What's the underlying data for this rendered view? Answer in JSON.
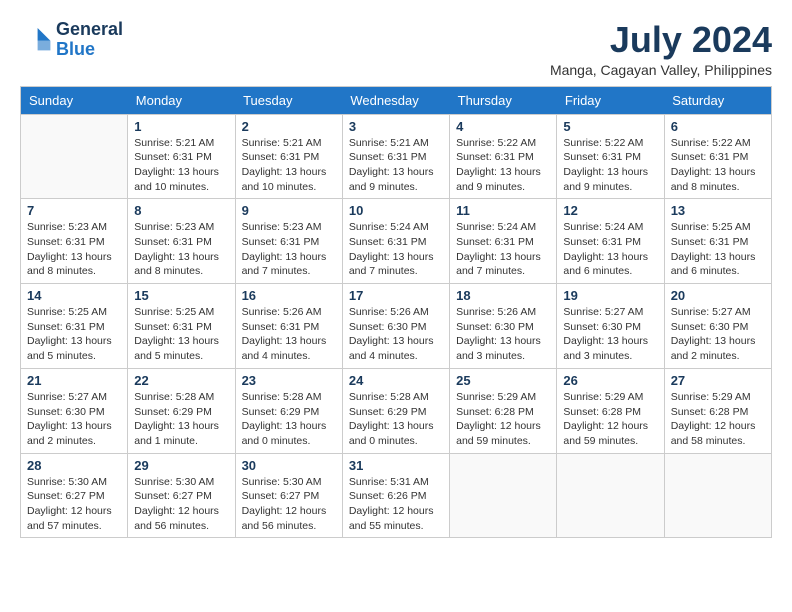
{
  "logo": {
    "line1": "General",
    "line2": "Blue"
  },
  "title": "July 2024",
  "location": "Manga, Cagayan Valley, Philippines",
  "days_header": [
    "Sunday",
    "Monday",
    "Tuesday",
    "Wednesday",
    "Thursday",
    "Friday",
    "Saturday"
  ],
  "weeks": [
    [
      {
        "day": "",
        "info": ""
      },
      {
        "day": "1",
        "info": "Sunrise: 5:21 AM\nSunset: 6:31 PM\nDaylight: 13 hours\nand 10 minutes."
      },
      {
        "day": "2",
        "info": "Sunrise: 5:21 AM\nSunset: 6:31 PM\nDaylight: 13 hours\nand 10 minutes."
      },
      {
        "day": "3",
        "info": "Sunrise: 5:21 AM\nSunset: 6:31 PM\nDaylight: 13 hours\nand 9 minutes."
      },
      {
        "day": "4",
        "info": "Sunrise: 5:22 AM\nSunset: 6:31 PM\nDaylight: 13 hours\nand 9 minutes."
      },
      {
        "day": "5",
        "info": "Sunrise: 5:22 AM\nSunset: 6:31 PM\nDaylight: 13 hours\nand 9 minutes."
      },
      {
        "day": "6",
        "info": "Sunrise: 5:22 AM\nSunset: 6:31 PM\nDaylight: 13 hours\nand 8 minutes."
      }
    ],
    [
      {
        "day": "7",
        "info": "Sunrise: 5:23 AM\nSunset: 6:31 PM\nDaylight: 13 hours\nand 8 minutes."
      },
      {
        "day": "8",
        "info": "Sunrise: 5:23 AM\nSunset: 6:31 PM\nDaylight: 13 hours\nand 8 minutes."
      },
      {
        "day": "9",
        "info": "Sunrise: 5:23 AM\nSunset: 6:31 PM\nDaylight: 13 hours\nand 7 minutes."
      },
      {
        "day": "10",
        "info": "Sunrise: 5:24 AM\nSunset: 6:31 PM\nDaylight: 13 hours\nand 7 minutes."
      },
      {
        "day": "11",
        "info": "Sunrise: 5:24 AM\nSunset: 6:31 PM\nDaylight: 13 hours\nand 7 minutes."
      },
      {
        "day": "12",
        "info": "Sunrise: 5:24 AM\nSunset: 6:31 PM\nDaylight: 13 hours\nand 6 minutes."
      },
      {
        "day": "13",
        "info": "Sunrise: 5:25 AM\nSunset: 6:31 PM\nDaylight: 13 hours\nand 6 minutes."
      }
    ],
    [
      {
        "day": "14",
        "info": "Sunrise: 5:25 AM\nSunset: 6:31 PM\nDaylight: 13 hours\nand 5 minutes."
      },
      {
        "day": "15",
        "info": "Sunrise: 5:25 AM\nSunset: 6:31 PM\nDaylight: 13 hours\nand 5 minutes."
      },
      {
        "day": "16",
        "info": "Sunrise: 5:26 AM\nSunset: 6:31 PM\nDaylight: 13 hours\nand 4 minutes."
      },
      {
        "day": "17",
        "info": "Sunrise: 5:26 AM\nSunset: 6:30 PM\nDaylight: 13 hours\nand 4 minutes."
      },
      {
        "day": "18",
        "info": "Sunrise: 5:26 AM\nSunset: 6:30 PM\nDaylight: 13 hours\nand 3 minutes."
      },
      {
        "day": "19",
        "info": "Sunrise: 5:27 AM\nSunset: 6:30 PM\nDaylight: 13 hours\nand 3 minutes."
      },
      {
        "day": "20",
        "info": "Sunrise: 5:27 AM\nSunset: 6:30 PM\nDaylight: 13 hours\nand 2 minutes."
      }
    ],
    [
      {
        "day": "21",
        "info": "Sunrise: 5:27 AM\nSunset: 6:30 PM\nDaylight: 13 hours\nand 2 minutes."
      },
      {
        "day": "22",
        "info": "Sunrise: 5:28 AM\nSunset: 6:29 PM\nDaylight: 13 hours\nand 1 minute."
      },
      {
        "day": "23",
        "info": "Sunrise: 5:28 AM\nSunset: 6:29 PM\nDaylight: 13 hours\nand 0 minutes."
      },
      {
        "day": "24",
        "info": "Sunrise: 5:28 AM\nSunset: 6:29 PM\nDaylight: 13 hours\nand 0 minutes."
      },
      {
        "day": "25",
        "info": "Sunrise: 5:29 AM\nSunset: 6:28 PM\nDaylight: 12 hours\nand 59 minutes."
      },
      {
        "day": "26",
        "info": "Sunrise: 5:29 AM\nSunset: 6:28 PM\nDaylight: 12 hours\nand 59 minutes."
      },
      {
        "day": "27",
        "info": "Sunrise: 5:29 AM\nSunset: 6:28 PM\nDaylight: 12 hours\nand 58 minutes."
      }
    ],
    [
      {
        "day": "28",
        "info": "Sunrise: 5:30 AM\nSunset: 6:27 PM\nDaylight: 12 hours\nand 57 minutes."
      },
      {
        "day": "29",
        "info": "Sunrise: 5:30 AM\nSunset: 6:27 PM\nDaylight: 12 hours\nand 56 minutes."
      },
      {
        "day": "30",
        "info": "Sunrise: 5:30 AM\nSunset: 6:27 PM\nDaylight: 12 hours\nand 56 minutes."
      },
      {
        "day": "31",
        "info": "Sunrise: 5:31 AM\nSunset: 6:26 PM\nDaylight: 12 hours\nand 55 minutes."
      },
      {
        "day": "",
        "info": ""
      },
      {
        "day": "",
        "info": ""
      },
      {
        "day": "",
        "info": ""
      }
    ]
  ]
}
